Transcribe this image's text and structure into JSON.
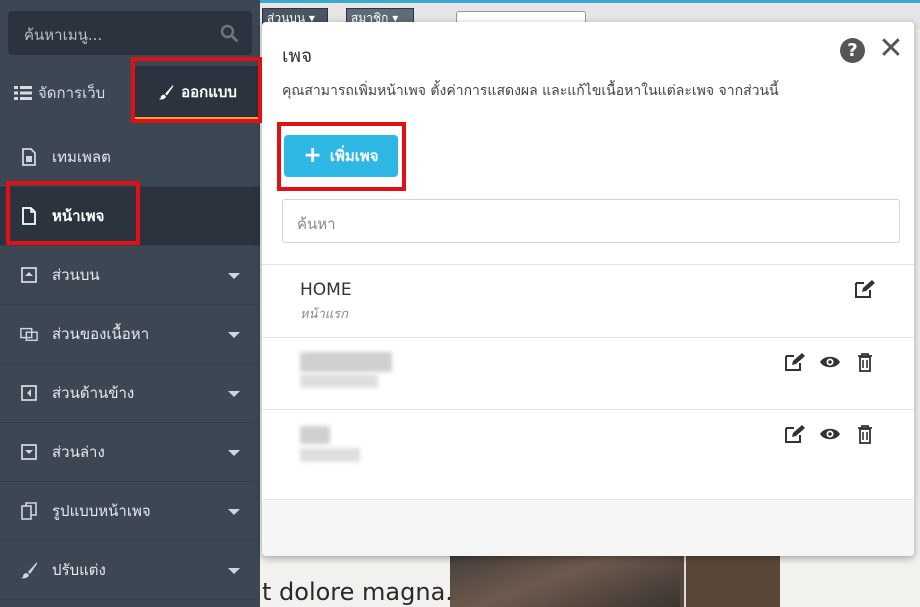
{
  "sidebar": {
    "search_placeholder": "ค้นหาเมนู...",
    "tabs": [
      {
        "label": "จัดการเว็บ",
        "icon": "list-icon"
      },
      {
        "label": "ออกแบบ",
        "icon": "paint-brush-icon"
      }
    ],
    "menu": [
      {
        "label": "เทมเพลต",
        "icon": "template-icon"
      },
      {
        "label": "หน้าเพจ",
        "icon": "page-icon"
      },
      {
        "label": "ส่วนบน",
        "icon": "header-icon"
      },
      {
        "label": "ส่วนของเนื้อหา",
        "icon": "content-icon"
      },
      {
        "label": "ส่วนด้านข้าง",
        "icon": "sidebar-icon"
      },
      {
        "label": "ส่วนล่าง",
        "icon": "footer-icon"
      },
      {
        "label": "รูปแบบหน้าเพจ",
        "icon": "copy-icon"
      },
      {
        "label": "ปรับแต่ง",
        "icon": "brush-icon"
      }
    ]
  },
  "background": {
    "select_1": "ส่วนบน ▾",
    "select_2": "สมาชิก ▾",
    "text_line": "t dolore magna."
  },
  "modal": {
    "title": "เพจ",
    "description": "คุณสามารถเพิ่มหน้าเพจ ตั้งค่าการแสดงผล และแก้ไขเนื้อหาในแต่ละเพจ จากส่วนนี้",
    "add_button": "เพิ่มเพจ",
    "search_placeholder": "ค้นหา",
    "pages": [
      {
        "name": "HOME",
        "subtitle": "หน้าแรก"
      }
    ]
  },
  "colors": {
    "sidebar_bg": "#3c4753",
    "sidebar_active": "#2b343e",
    "accent_orange": "#f3a534",
    "button_blue": "#2fb8e3",
    "highlight_red": "#e10f16"
  }
}
